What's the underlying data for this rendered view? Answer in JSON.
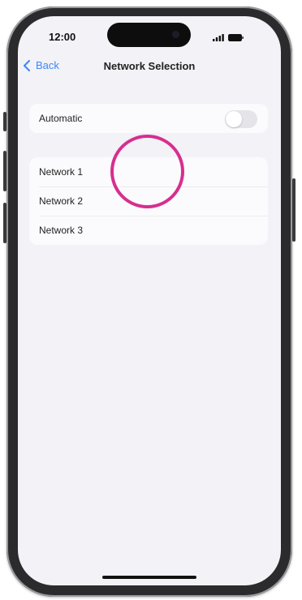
{
  "status_bar": {
    "time": "12:00",
    "icons": [
      "cellular-signal-icon",
      "battery-icon"
    ]
  },
  "nav": {
    "back_label": "Back",
    "back_icon": "chevron-left-icon",
    "title": "Network Selection"
  },
  "automatic": {
    "label": "Automatic",
    "enabled": false
  },
  "networks": [
    {
      "label": "Network 1"
    },
    {
      "label": "Network 2"
    },
    {
      "label": "Network 3"
    }
  ],
  "colors": {
    "accent": "#3f86f7",
    "tap_indicator": "#d62f8f",
    "background": "#f2f2f7"
  }
}
